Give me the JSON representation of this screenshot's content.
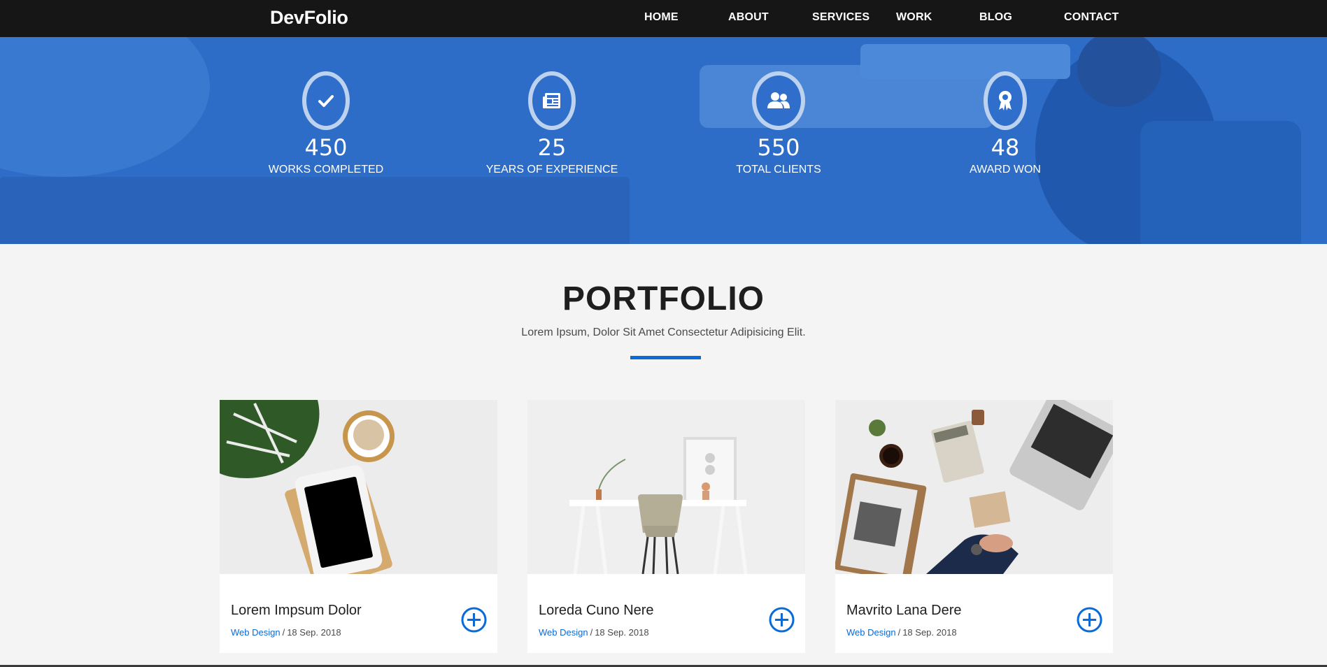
{
  "brand": "DevFolio",
  "nav": {
    "items": [
      "HOME",
      "ABOUT",
      "SERVICES",
      "WORK",
      "BLOG",
      "CONTACT"
    ]
  },
  "counters": [
    {
      "number": "450",
      "label": "WORKS COMPLETED",
      "icon": "check-icon"
    },
    {
      "number": "25",
      "label": "YEARS OF EXPERIENCE",
      "icon": "newspaper-icon"
    },
    {
      "number": "550",
      "label": "TOTAL CLIENTS",
      "icon": "users-icon"
    },
    {
      "number": "48",
      "label": "AWARD WON",
      "icon": "award-icon"
    }
  ],
  "portfolio": {
    "title": "PORTFOLIO",
    "subtitle": "Lorem Ipsum, Dolor Sit Amet Consectetur Adipisicing Elit.",
    "cards": [
      {
        "title": "Lorem Impsum Dolor",
        "category": "Web Design",
        "separator": "/",
        "date": "18 Sep. 2018",
        "image": "workspace-tablet-plant-photo"
      },
      {
        "title": "Loreda Cuno Nere",
        "category": "Web Design",
        "separator": "/",
        "date": "18 Sep. 2018",
        "image": "white-desk-chair-photo"
      },
      {
        "title": "Mavrito Lana Dere",
        "category": "Web Design",
        "separator": "/",
        "date": "18 Sep. 2018",
        "image": "business-desk-laptop-photo"
      }
    ]
  },
  "colors": {
    "navbar": "#161616",
    "hero_overlay": "#2d6cc7",
    "accent": "#0a6ad8",
    "page_bg": "#f4f4f4"
  }
}
